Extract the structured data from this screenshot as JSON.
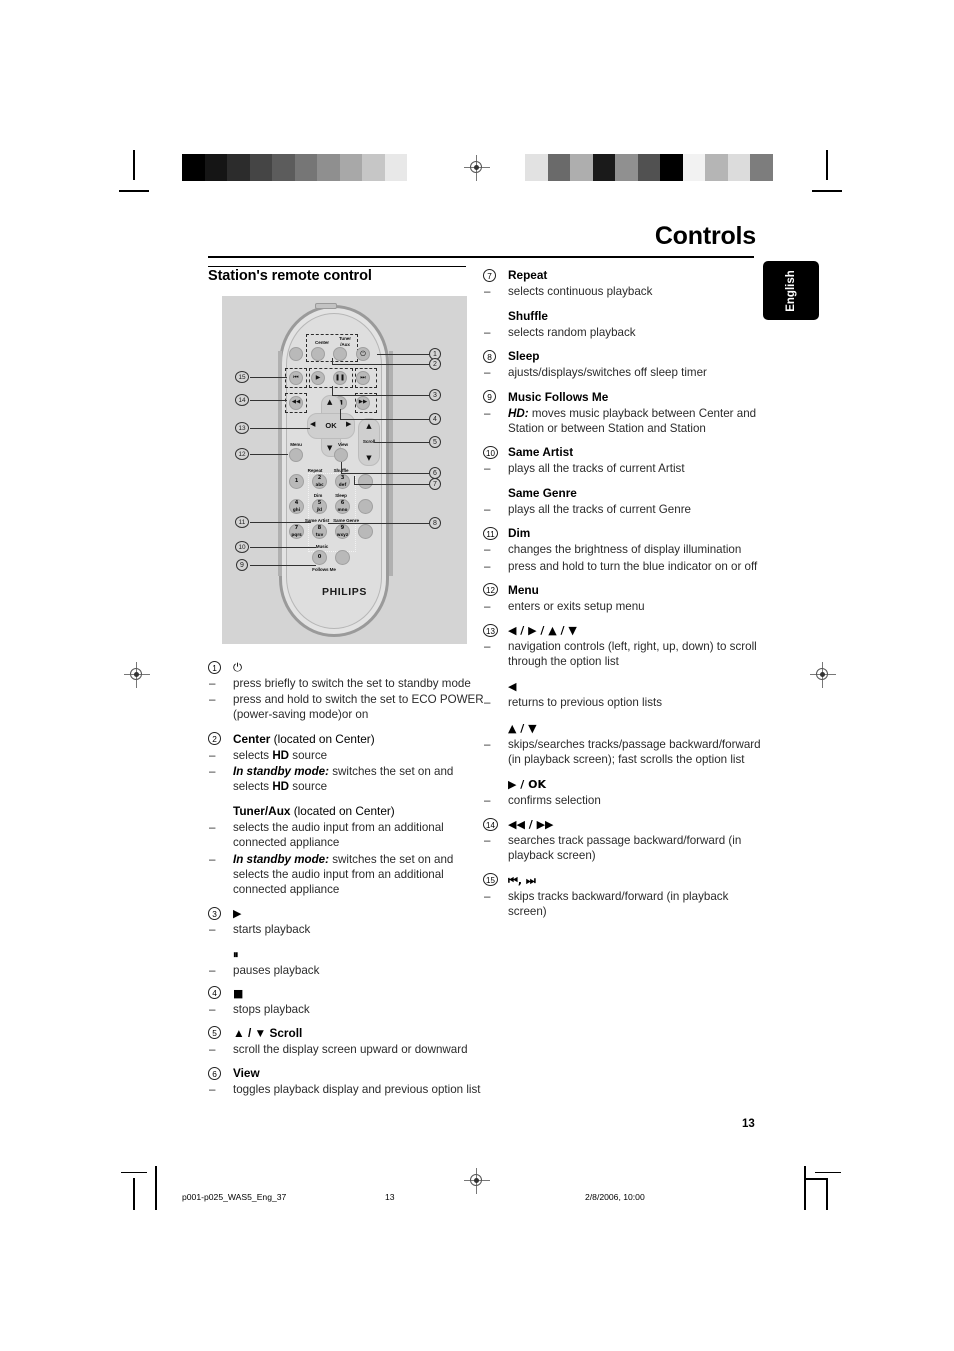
{
  "header": {
    "title": "Controls",
    "language_tab": "English"
  },
  "left_column": {
    "section_title": "Station's remote control"
  },
  "footer": {
    "page_number": "13",
    "file_name": "p001-p025_WAS5_Eng_37",
    "page_marker": "13",
    "timestamp": "2/8/2006, 10:00"
  },
  "remote": {
    "brand": "PHILIPS",
    "labels": {
      "center": "Center",
      "tuner_aux_line1": "Tuner",
      "tuner_aux_line2": "/Aux",
      "ok": "OK",
      "menu": "Menu",
      "view": "View",
      "scroll": "Scroll",
      "repeat": "Repeat",
      "shuffle": "Shuffle",
      "dim": "Dim",
      "sleep": "Sleep",
      "same_artist": "Same Artist",
      "same_genre": "Same Genre",
      "music": "Music",
      "follows_me": "Follows Me",
      "power": "⏻",
      "prev_track": "⏮",
      "play": "▶",
      "pause": "⏸",
      "next_track": "⏭",
      "rewind": "◀◀",
      "stop": "■",
      "fast_forward": "▶▶",
      "nav_left": "◀",
      "nav_right": "▶",
      "nav_up": "▲",
      "nav_down": "▼",
      "scroll_up": "▲",
      "scroll_down": "▼"
    },
    "keypad": [
      {
        "digit": "1",
        "letters": ""
      },
      {
        "digit": "2",
        "letters": "abc"
      },
      {
        "digit": "3",
        "letters": "def"
      },
      {
        "digit": "4",
        "letters": "ghi"
      },
      {
        "digit": "5",
        "letters": "jkl"
      },
      {
        "digit": "6",
        "letters": "mno"
      },
      {
        "digit": "7",
        "letters": "pqrs"
      },
      {
        "digit": "8",
        "letters": "tuv"
      },
      {
        "digit": "9",
        "letters": "wxyz"
      },
      {
        "digit": "0",
        "letters": ""
      }
    ],
    "callouts_right": [
      "1",
      "2",
      "3",
      "4",
      "5",
      "6",
      "7",
      "8"
    ],
    "callouts_left": [
      "15",
      "14",
      "13",
      "12",
      "11",
      "10",
      "9"
    ]
  },
  "entries": {
    "e1": {
      "num": "1",
      "label": "⏻",
      "bullets": [
        "press briefly to switch the set to standby mode",
        "press and hold to switch the set to ECO POWER (power-saving mode)or on"
      ]
    },
    "e2": {
      "num": "2",
      "label": "Center",
      "label_suffix": "(located on Center)",
      "bullets_1_pre": "selects ",
      "bullets_1_bold": "HD",
      "bullets_1_post": " source",
      "bullets_2_em": "In standby mode:",
      "bullets_2_pre": " switches the set on and selects ",
      "bullets_2_bold": "HD",
      "bullets_2_post": " source",
      "sub_label": "Tuner/Aux",
      "sub_label_suffix": "(located on Center)",
      "sub_bullet_1": "selects the audio input from an additional connected appliance",
      "sub_bullet_2_em": "In standby mode:",
      "sub_bullet_2_rest": " switches the set on and selects  the audio input from an additional connected appliance"
    },
    "e3": {
      "num": "3",
      "label": "▶",
      "bullet": "starts playback",
      "sub_label": "⏸",
      "sub_bullet": "pauses playback"
    },
    "e4": {
      "num": "4",
      "label": "■",
      "bullet": "stops playback"
    },
    "e5": {
      "num": "5",
      "label": "▲ / ▼ Scroll",
      "bullet": "scroll the display screen upward or downward"
    },
    "e6": {
      "num": "6",
      "label": "View",
      "bullet": "toggles playback display and previous option list"
    },
    "e7": {
      "num": "7",
      "label": "Repeat",
      "bullet": "selects continuous playback",
      "sub_label": "Shuffle",
      "sub_bullet": "selects random playback"
    },
    "e8": {
      "num": "8",
      "label": "Sleep",
      "bullet": "ajusts/displays/switches off sleep timer"
    },
    "e9": {
      "num": "9",
      "label": "Music Follows Me",
      "bullet_em": "HD:",
      "bullet_rest": " moves music playback between Center and Station or between Station and Station"
    },
    "e10": {
      "num": "10",
      "label": "Same Artist",
      "bullet": "plays all the tracks of current Artist",
      "sub_label": "Same Genre",
      "sub_bullet": "plays all the tracks of current Genre"
    },
    "e11": {
      "num": "11",
      "label": "Dim",
      "bullets": [
        "changes the brightness of display illumination",
        "press and hold to turn the blue indicator on or off"
      ]
    },
    "e12": {
      "num": "12",
      "label": "Menu",
      "bullet": "enters or exits setup menu"
    },
    "e13": {
      "num": "13",
      "label": "◀ / ▶ / ▲ / ▼",
      "bullet": "navigation controls (left, right, up, down) to scroll through the option list",
      "sub_label_1": "◀",
      "sub_bullet_1": "returns to previous option lists",
      "sub_label_2": "▲ / ▼",
      "sub_bullet_2": "skips/searches tracks/passage backward/forward (in playback screen); fast scrolls the option list",
      "sub_label_3": "▶ / OK",
      "sub_bullet_3": "confirms selection"
    },
    "e14": {
      "num": "14",
      "label": "◀◀ /  ▶▶",
      "bullet": "searches track passage backward/forward (in playback screen)"
    },
    "e15": {
      "num": "15",
      "label": "⏮, ⏭",
      "bullet": "skips tracks backward/forward (in playback screen)"
    }
  },
  "print_marks": {
    "greyscale_left": [
      "#000000",
      "#151515",
      "#2c2c2c",
      "#454545",
      "#5c5c5c",
      "#767676",
      "#8f8f8f",
      "#a8a8a8",
      "#c6c6c6",
      "#e8e8e8",
      "#ffffff"
    ],
    "greyscale_right": [
      "#e2e2e2",
      "#6a6a6a",
      "#aeaeae",
      "#1a1a1a",
      "#909090",
      "#515151",
      "#000000",
      "#f2f2f2",
      "#b5b5b5",
      "#dcdcdc",
      "#7d7d7d"
    ]
  }
}
